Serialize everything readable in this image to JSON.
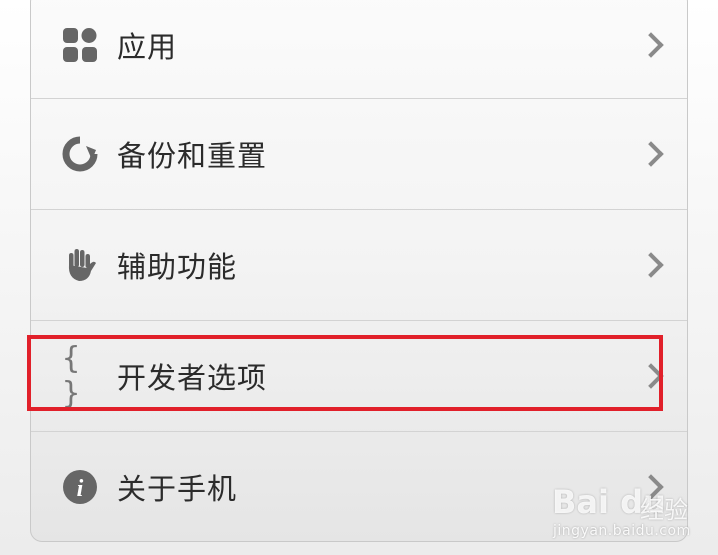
{
  "settings_list": [
    {
      "icon": "apps-icon",
      "label": "应用"
    },
    {
      "icon": "backup-reset-icon",
      "label": "备份和重置"
    },
    {
      "icon": "hand-accessibility-icon",
      "label": "辅助功能"
    },
    {
      "icon": "braces-developer-icon",
      "label": "开发者选项",
      "highlighted": true
    },
    {
      "icon": "info-icon",
      "label": "关于手机"
    }
  ],
  "developer_icon_glyph": "{ }",
  "info_icon_glyph": "i",
  "watermark": {
    "logo": "Bai du",
    "chinese": "经验",
    "url": "jingyan.baidu.com"
  },
  "colors": {
    "highlight": "#e1202a",
    "icon": "#666666",
    "chevron": "#8a8a8a",
    "text": "#2b2b2b"
  }
}
